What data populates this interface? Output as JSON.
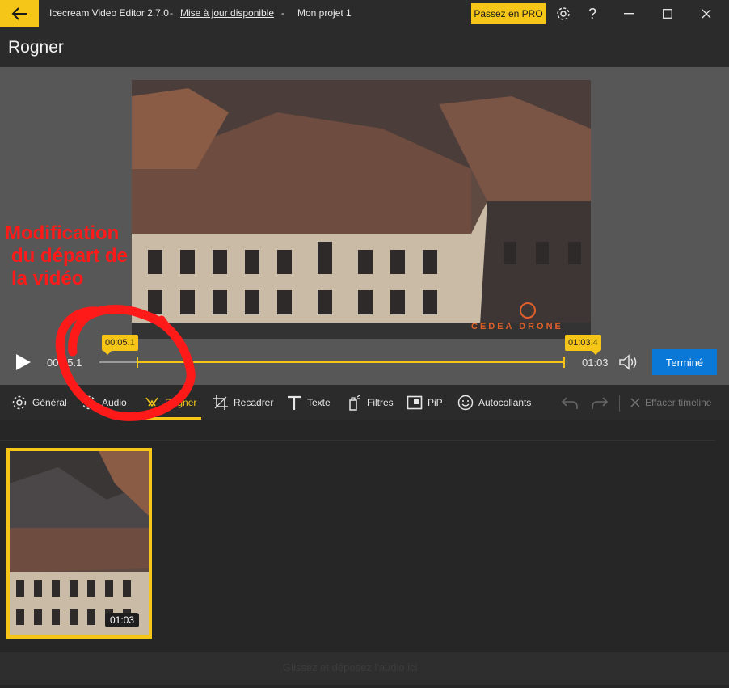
{
  "titlebar": {
    "app_name": "Icecream Video Editor 2.7.0",
    "separator": "-",
    "update_link": "Mise à jour disponible",
    "separator2": "-",
    "project_name": "Mon projet 1",
    "pro_button": "Passez en PRO",
    "icons": [
      "back-arrow-icon",
      "gear-icon",
      "help-icon",
      "minimize-icon",
      "maximize-icon",
      "close-icon"
    ]
  },
  "header": {
    "title": "Rogner"
  },
  "player": {
    "current_time": "00:05.1",
    "end_time": "01:03",
    "trim_start": "00:05.1",
    "trim_start_ms": ".1",
    "trim_start_main": "00:05",
    "trim_end_main": "01:03",
    "trim_end_ms": ".4",
    "done_button": "Terminé"
  },
  "toolbar": {
    "items": [
      {
        "label": "Général",
        "icon": "gear-icon"
      },
      {
        "label": "Audio",
        "icon": "audio-icon"
      },
      {
        "label": "Rogner",
        "icon": "trim-icon"
      },
      {
        "label": "Recadrer",
        "icon": "crop-icon"
      },
      {
        "label": "Texte",
        "icon": "text-icon"
      },
      {
        "label": "Filtres",
        "icon": "filter-icon"
      },
      {
        "label": "PiP",
        "icon": "pip-icon"
      },
      {
        "label": "Autocollants",
        "icon": "sticker-icon"
      }
    ],
    "clear_timeline": "Effacer timeline"
  },
  "timeline": {
    "clip_duration": "01:03",
    "audio_drop_text": "Glissez et déposez l'audio ici"
  },
  "annotation": {
    "line1": "Modification",
    "line2": "du départ de",
    "line3": "la vidéo"
  },
  "colors": {
    "accent": "#f5c518",
    "primary_button": "#0a78d7",
    "annotation": "#ff1a1a"
  }
}
